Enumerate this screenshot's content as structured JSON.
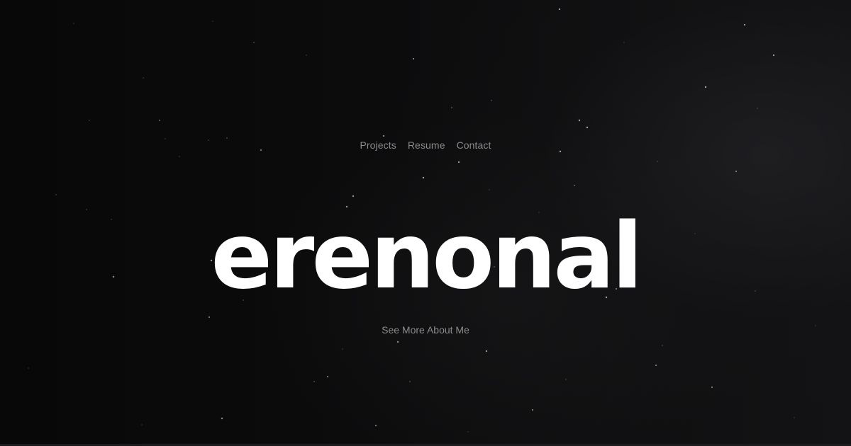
{
  "nav": {
    "items": [
      {
        "label": "Projects"
      },
      {
        "label": "Resume"
      },
      {
        "label": "Contact"
      }
    ]
  },
  "hero": {
    "logo_text": "erenonal",
    "cta_label": "See More About Me"
  },
  "colors": {
    "background": "#0a0a0a",
    "text_muted": "#8a8a8e",
    "logo": "#ffffff",
    "star": "#ffffff"
  }
}
